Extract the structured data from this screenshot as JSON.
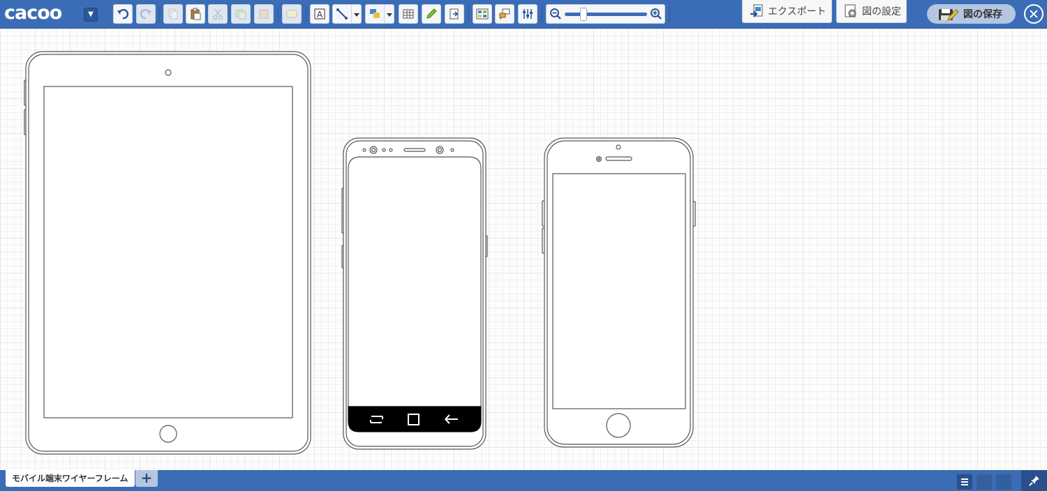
{
  "app": {
    "logo_text": "cacoo",
    "accent_color": "#3a6db5"
  },
  "toolbar": {
    "icons": [
      "undo-icon",
      "redo-icon",
      "copy-icon",
      "paste-icon",
      "cut-icon",
      "duplicate-icon",
      "paste-format-icon",
      "shape-icon",
      "text-icon",
      "connector-icon",
      "stencil-icon",
      "table-icon",
      "pen-icon",
      "import-icon",
      "image-icon",
      "comment-icon",
      "align-icon",
      "zoom-out-icon",
      "zoom-in-icon"
    ],
    "zoom_level": 0.2
  },
  "header_actions": {
    "export_label": "エクスポート",
    "settings_label": "図の設定",
    "save_label": "図の保存"
  },
  "sheets": {
    "tabs": [
      {
        "label": "モバイル端末ワイヤーフレーム",
        "active": true
      }
    ],
    "add_label": "+"
  },
  "canvas": {
    "shapes": [
      "tablet-wireframe",
      "android-phone-wireframe",
      "iphone-wireframe"
    ]
  }
}
